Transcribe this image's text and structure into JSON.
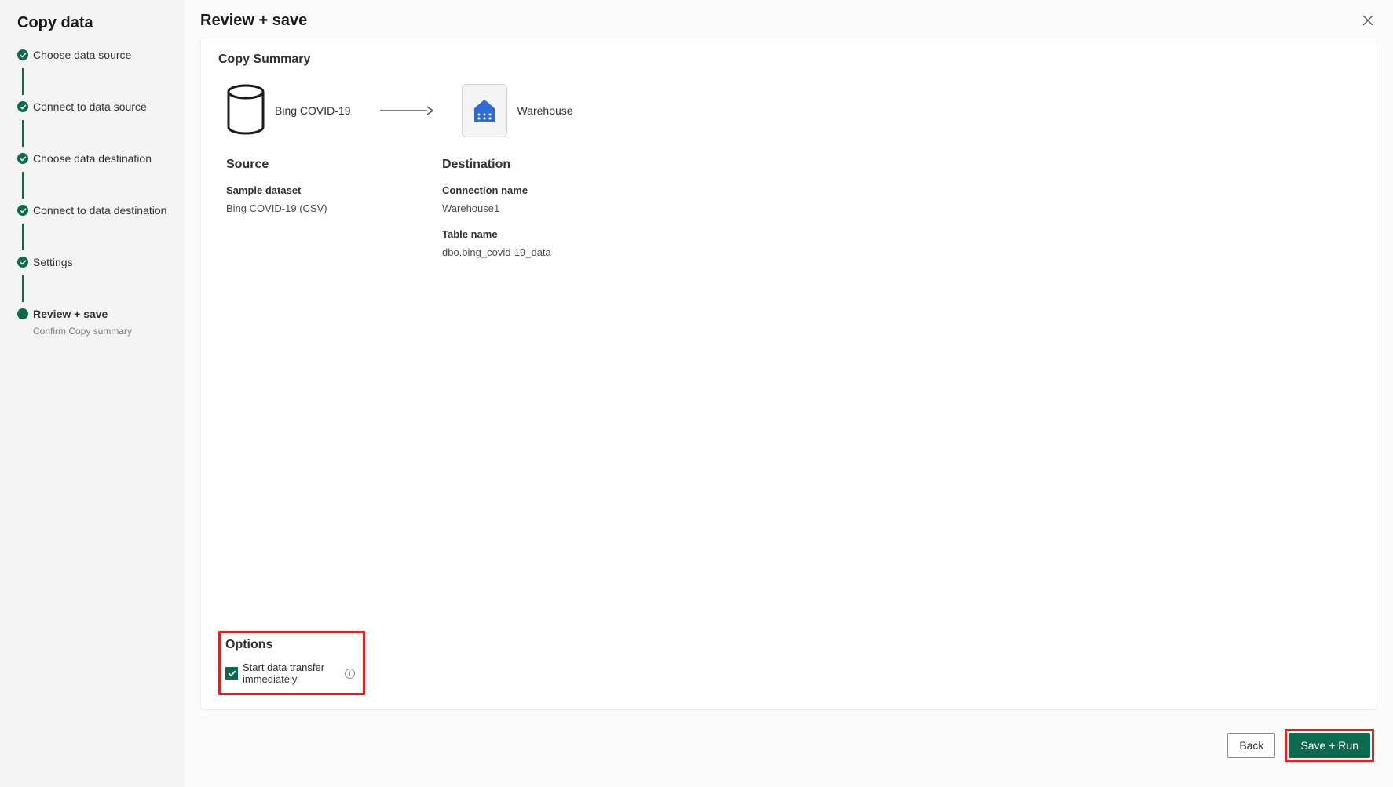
{
  "sidebar": {
    "title": "Copy data",
    "steps": [
      {
        "label": "Choose data source",
        "done": true
      },
      {
        "label": "Connect to data source",
        "done": true
      },
      {
        "label": "Choose data destination",
        "done": true
      },
      {
        "label": "Connect to data destination",
        "done": true
      },
      {
        "label": "Settings",
        "done": true
      },
      {
        "label": "Review + save",
        "done": false,
        "active": true,
        "sublabel": "Confirm Copy summary"
      }
    ]
  },
  "header": {
    "title": "Review + save"
  },
  "summary": {
    "heading": "Copy Summary",
    "diagram": {
      "source_label": "Bing COVID-19",
      "destination_label": "Warehouse"
    },
    "source": {
      "title": "Source",
      "fields": [
        {
          "label": "Sample dataset",
          "value": "Bing COVID-19 (CSV)"
        }
      ]
    },
    "destination": {
      "title": "Destination",
      "fields": [
        {
          "label": "Connection name",
          "value": "Warehouse1"
        },
        {
          "label": "Table name",
          "value": "dbo.bing_covid-19_data"
        }
      ]
    }
  },
  "options": {
    "heading": "Options",
    "checkbox_label": "Start data transfer immediately",
    "checked": true
  },
  "footer": {
    "back_label": "Back",
    "save_run_label": "Save + Run"
  }
}
